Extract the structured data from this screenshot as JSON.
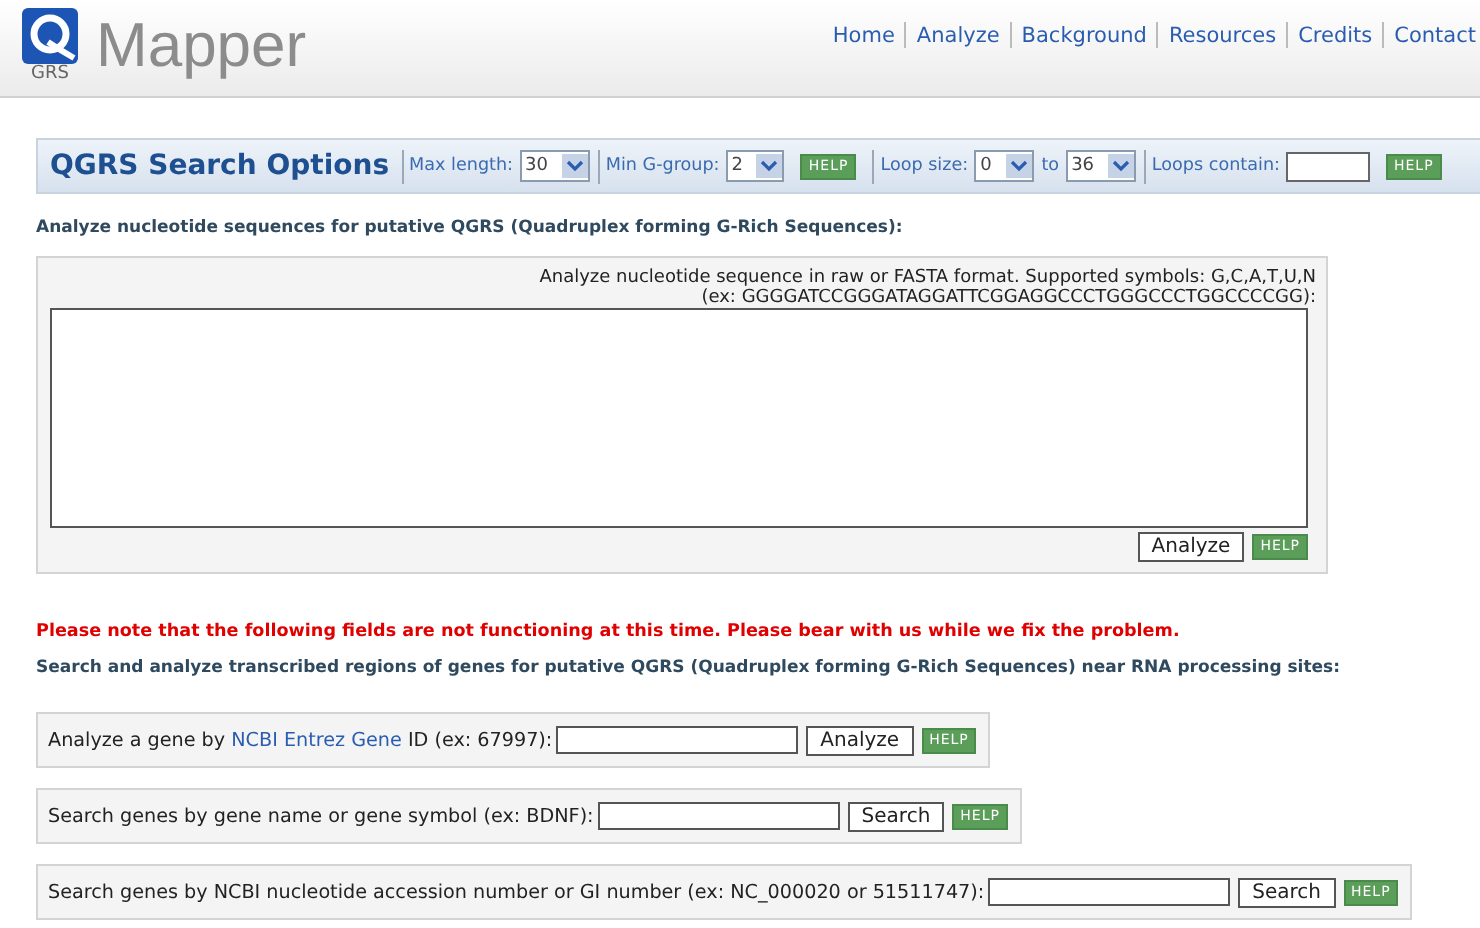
{
  "header": {
    "logo_text": "GRS",
    "title": "Mapper",
    "nav": [
      "Home",
      "Analyze",
      "Background",
      "Resources",
      "Credits",
      "Contact"
    ]
  },
  "options": {
    "title": "QGRS Search Options",
    "controls": [
      {
        "kind": "select",
        "divider_before": true,
        "label": "Max length:",
        "value": "30"
      },
      {
        "kind": "select",
        "divider_before": true,
        "label": "Min G-group:",
        "value": "2"
      },
      {
        "kind": "help",
        "divider_before": false,
        "label": "HELP"
      },
      {
        "kind": "select",
        "divider_before": true,
        "label": "Loop size:",
        "value": "0"
      },
      {
        "kind": "select",
        "divider_before": false,
        "label": "to",
        "value": "36"
      },
      {
        "kind": "input",
        "divider_before": true,
        "label": "Loops contain:"
      },
      {
        "kind": "help",
        "divider_before": false,
        "label": "HELP"
      }
    ]
  },
  "sequence": {
    "heading": "Analyze nucleotide sequences for putative QGRS (Quadruplex forming G-Rich Sequences):",
    "instructions": [
      "Analyze nucleotide sequence in raw or FASTA format. Supported symbols: G,C,A,T,U,N",
      "(ex: GGGGATCCGGGATAGGATTCGGAGGCCCTGGGCCCTGGCCCCGG):"
    ],
    "button": "Analyze",
    "help": "HELP"
  },
  "notice": "Please note that the following fields are not functioning at this time. Please bear with us while we fix the problem.",
  "genes": {
    "heading": "Search and analyze transcribed regions of genes for putative QGRS (Quadruplex forming G-Rich Sequences) near RNA processing sites:",
    "rows": [
      {
        "label": "Analyze a gene by ",
        "link": "NCBI Entrez Gene",
        "label_after": " ID (ex: 67997):",
        "button": "Analyze",
        "help": "HELP"
      },
      {
        "label": "Search genes by gene name or gene symbol (ex: BDNF):",
        "button": "Search",
        "help": "HELP"
      },
      {
        "label": "Search genes by NCBI nucleotide accession number or GI number (ex: NC_000020 or 51511747):",
        "button": "Search",
        "help": "HELP"
      }
    ]
  }
}
